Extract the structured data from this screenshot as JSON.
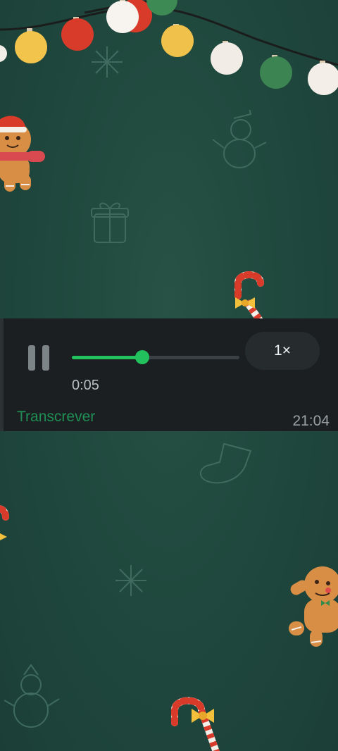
{
  "audio_message": {
    "elapsed": "0:05",
    "progress_fraction": 0.42,
    "speed_label": "1×",
    "transcribe_label": "Transcrever",
    "timestamp": "21:04"
  },
  "icons": {
    "play_state": "pause-icon"
  },
  "colors": {
    "wallpaper": "#1f473d",
    "player_background": "#1c1f21",
    "accent_green": "#22c15e",
    "transcribe_green": "#1f8f55"
  }
}
